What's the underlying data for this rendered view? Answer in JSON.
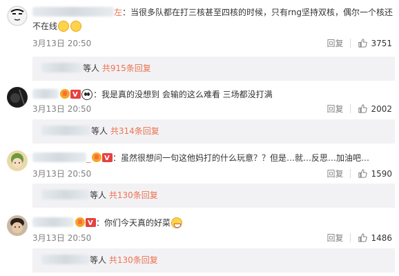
{
  "comments": [
    {
      "text": "：当很多队都在打三核甚至四核的时候，只有rng坚持双核，偶尔一个核还不在线",
      "date": "3月13日 20:50",
      "reply_label": "回复",
      "likes": "3751",
      "sub_people": "等人",
      "sub_total": "共915条回复"
    },
    {
      "text": "：我是真的没想到 会输的这么难看 三场都没打满",
      "date": "3月13日 20:50",
      "reply_label": "回复",
      "likes": "2002",
      "sub_people": "等人",
      "sub_total": "共314条回复"
    },
    {
      "text": "：虽然很想问一句这他妈打的什么玩意？？但是…就…反思…加油吧…",
      "date": "3月13日 20:50",
      "reply_label": "回复",
      "likes": "1590",
      "sub_people": "等人",
      "sub_total": "共130条回复"
    },
    {
      "text": "：你们今天真的好菜",
      "date": "3月13日 20:50",
      "reply_label": "回复",
      "likes": "1486",
      "sub_people": "等人",
      "sub_total": "共130条回复"
    }
  ],
  "colors": {
    "accent": "#eb7350",
    "meta": "#808080",
    "sub_bg": "#f2f2f5"
  },
  "icons": [
    "like-icon",
    "avatar",
    "vip-badge-icon",
    "emoji"
  ]
}
